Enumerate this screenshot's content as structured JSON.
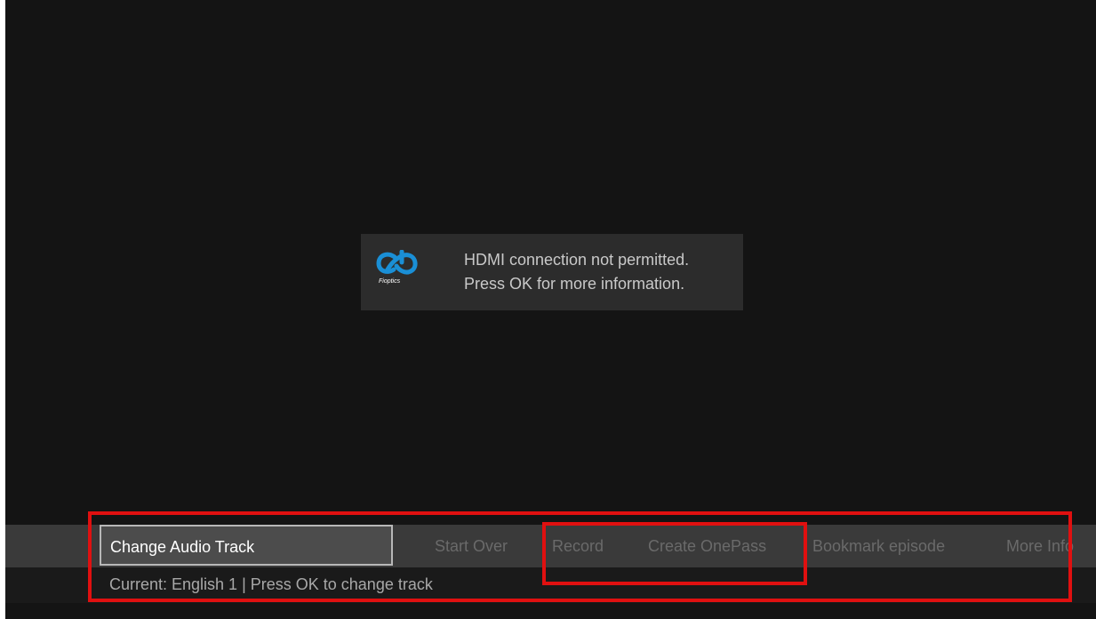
{
  "notification": {
    "logo_text": "Fioptics",
    "line1": "HDMI connection not permitted.",
    "line2": "Press OK for more information."
  },
  "menu": {
    "items": [
      {
        "label": "Change Audio Track",
        "selected": true
      },
      {
        "label": "Start Over",
        "selected": false
      },
      {
        "label": "Record",
        "selected": false
      },
      {
        "label": "Create OnePass",
        "selected": false
      },
      {
        "label": "Bookmark episode",
        "selected": false
      },
      {
        "label": "More Info",
        "selected": false
      }
    ],
    "status": "Current: English 1 | Press OK to change track"
  },
  "colors": {
    "screen_bg": "#141414",
    "toast_bg": "#2c2c2c",
    "logo_blue": "#1a8fd6",
    "annotation": "#e01010"
  },
  "icons": {
    "logo": "fioptics-logo-icon"
  }
}
